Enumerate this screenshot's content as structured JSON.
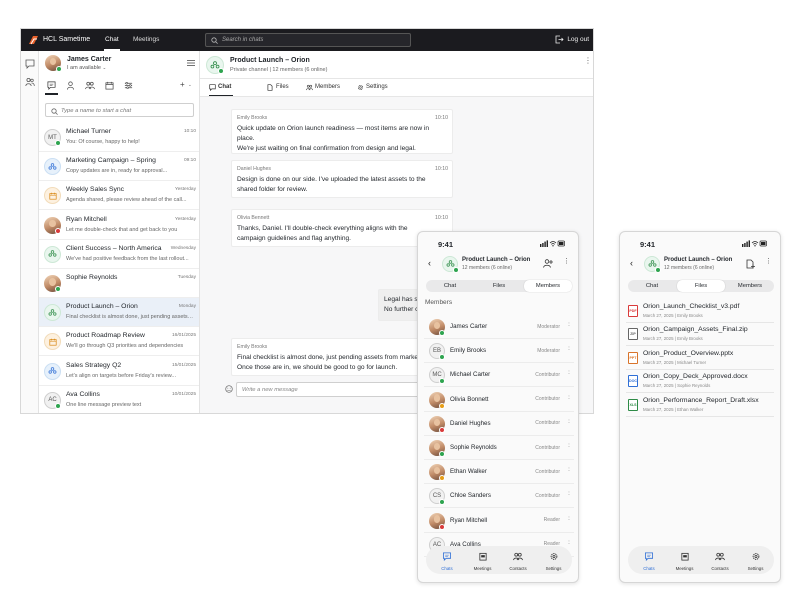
{
  "topbar": {
    "app_name": "HCL Sametime",
    "nav": [
      "Chat",
      "Meetings"
    ],
    "search_placeholder": "Search in chats",
    "logout": "Log out"
  },
  "user": {
    "name": "James Carter",
    "status": "I am available"
  },
  "sidebar": {
    "search_placeholder": "Type a name to start a chat",
    "chats": [
      {
        "name": "Michael Turner",
        "preview": "You: Of course, happy to help!",
        "time": "10:10",
        "avatar": "MT",
        "type": "initials",
        "status": "green"
      },
      {
        "name": "Marketing Campaign – Spring",
        "preview": "Copy updates are in, ready for approval...",
        "time": "09:10",
        "type": "group-blue"
      },
      {
        "name": "Weekly Sales Sync",
        "preview": "Agenda shared, please review ahead of the call...",
        "time": "Yesterday",
        "type": "group-orange"
      },
      {
        "name": "Ryan Mitchell",
        "preview": "Let me double-check that and get back to you",
        "time": "Yesterday",
        "type": "photo",
        "status": "red"
      },
      {
        "name": "Client Success – North America",
        "preview": "We've had positive feedback from the last rollout...",
        "time": "Wednesday",
        "type": "group-green"
      },
      {
        "name": "Sophie Reynolds",
        "preview": "",
        "time": "Tuesday",
        "type": "photo",
        "status": "green"
      },
      {
        "name": "Product Launch – Orion",
        "preview": "Final checklist is almost done, just pending assets from...",
        "time": "Monday",
        "type": "group-green"
      },
      {
        "name": "Product Roadmap Review",
        "preview": "We'll go through Q3 priorities and dependencies",
        "time": "16/01/2025",
        "type": "group-orange"
      },
      {
        "name": "Sales Strategy Q2",
        "preview": "Let's align on targets before Friday's review...",
        "time": "15/01/2025",
        "type": "group-blue"
      },
      {
        "name": "Ava Collins",
        "preview": "One line message preview text",
        "time": "10/01/2025",
        "avatar": "AC",
        "type": "initials",
        "status": "green"
      }
    ]
  },
  "channel": {
    "title": "Product Launch – Orion",
    "subtitle": "Private channel | 12 members (6 online)",
    "tabs": [
      "Chat",
      "Files",
      "Members",
      "Settings"
    ]
  },
  "messages": [
    {
      "sender": "Emily Brooks",
      "time": "10:10",
      "lines": [
        "Quick update on Orion launch readiness — most items are now in",
        "place.",
        "We're just waiting on final confirmation from design and legal."
      ]
    },
    {
      "sender": "Daniel Hughes",
      "time": "10:10",
      "lines": [
        "Design is done on our side. I've uploaded the latest assets to the",
        "shared folder for review."
      ]
    },
    {
      "sender": "Olivia Bennett",
      "time": "10:10",
      "lines": [
        "Thanks, Daniel. I'll double-check everything aligns with the",
        "campaign guidelines and flag anything."
      ]
    },
    {
      "sender": "",
      "time": "",
      "lines": [
        "Legal has signed o",
        "No further change"
      ]
    },
    {
      "sender": "Emily Brooks",
      "time": "10:10",
      "lines": [
        "Final checklist is almost done, just pending assets from marketing.",
        "Once those are in, we should be good to go for launch."
      ]
    }
  ],
  "composer": {
    "placeholder": "Write a new message"
  },
  "phone_members": {
    "time": "9:41",
    "title": "Product Launch – Orion",
    "subtitle": "12 members (6 online)",
    "segments": [
      "Chat",
      "Files",
      "Members"
    ],
    "section": "Members",
    "members": [
      {
        "name": "James Carter",
        "role": "Moderator",
        "type": "photo",
        "status": "green"
      },
      {
        "name": "Emily Brooks",
        "role": "Moderator",
        "type": "initials",
        "avatar": "EB",
        "status": "green"
      },
      {
        "name": "Michael Carter",
        "role": "Contributor",
        "type": "initials",
        "avatar": "MC",
        "status": "green"
      },
      {
        "name": "Olivia Bonnett",
        "role": "Contributor",
        "type": "photo",
        "status": "orange"
      },
      {
        "name": "Daniel Hughes",
        "role": "Contributor",
        "type": "photo",
        "status": "red"
      },
      {
        "name": "Sophie Reynolds",
        "role": "Contributor",
        "type": "photo",
        "status": "green"
      },
      {
        "name": "Ethan Walker",
        "role": "Contributor",
        "type": "photo",
        "status": "orange"
      },
      {
        "name": "Chloe Sanders",
        "role": "Contributor",
        "type": "initials",
        "avatar": "CS",
        "status": "green"
      },
      {
        "name": "Ryan Mitchell",
        "role": "Reader",
        "type": "photo",
        "status": "red"
      },
      {
        "name": "Ava Collins",
        "role": "Reader",
        "type": "initials",
        "avatar": "AC",
        "status": "green"
      }
    ],
    "tabbar": [
      "Chats",
      "Meetings",
      "Contacts",
      "Settings"
    ]
  },
  "phone_files": {
    "time": "9:41",
    "title": "Product Launch – Orion",
    "subtitle": "12 members (6 online)",
    "segments": [
      "Chat",
      "Files",
      "Members"
    ],
    "files": [
      {
        "name": "Orion_Launch_Checklist_v3.pdf",
        "meta": "March 27, 2025 | Emily Brooks",
        "kind": "PDF",
        "color": "#d93a3a"
      },
      {
        "name": "Orion_Campaign_Assets_Final.zip",
        "meta": "March 27, 2025 | Emily Brooks",
        "kind": "ZIP",
        "color": "#666666"
      },
      {
        "name": "Orion_Product_Overview.pptx",
        "meta": "March 27, 2025 | Michael Turner",
        "kind": "PPT",
        "color": "#d9742a"
      },
      {
        "name": "Orion_Copy_Deck_Approved.docx",
        "meta": "March 27, 2025 | Sophie Reynolds",
        "kind": "DOC",
        "color": "#2f6fd6"
      },
      {
        "name": "Orion_Performance_Report_Draft.xlsx",
        "meta": "March 27, 2025 | Ethan Walker",
        "kind": "XLS",
        "color": "#2e8b47"
      }
    ],
    "tabbar": [
      "Chats",
      "Meetings",
      "Contacts",
      "Settings"
    ]
  },
  "colors": {
    "accent": "#2f6fd6",
    "online": "#2ea44f",
    "busy": "#d93a3a",
    "away": "#e69d17",
    "topbar": "#1b1b1f"
  }
}
